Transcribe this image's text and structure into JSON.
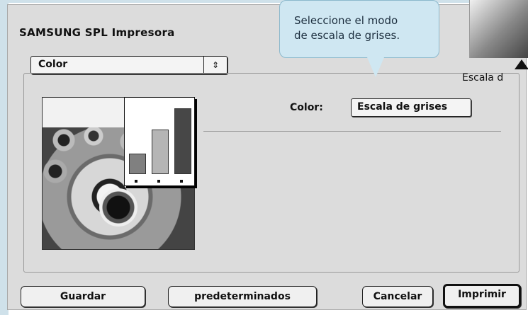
{
  "dialog": {
    "title": "SAMSUNG SPL Impresora",
    "panel_menu": {
      "selected": "Color",
      "arrow_glyph": "⇕"
    }
  },
  "color_setting": {
    "label": "Color:",
    "selected": "Escala de grises"
  },
  "callout": {
    "line1": "Seleccione el modo",
    "line2": "de escala de grises."
  },
  "corner_caption": "Escala d",
  "buttons": {
    "save": "Guardar",
    "defaults": "predeterminados",
    "cancel": "Cancelar",
    "print": "Imprimir"
  },
  "colors": {
    "dialog_bg": "#dcdcdc",
    "callout_bg": "#cfe7f2",
    "bar_light": "#b5b5b5",
    "bar_mid": "#808080",
    "bar_dark": "#474747"
  },
  "preview_bars": [
    0.27,
    0.59,
    0.88
  ]
}
